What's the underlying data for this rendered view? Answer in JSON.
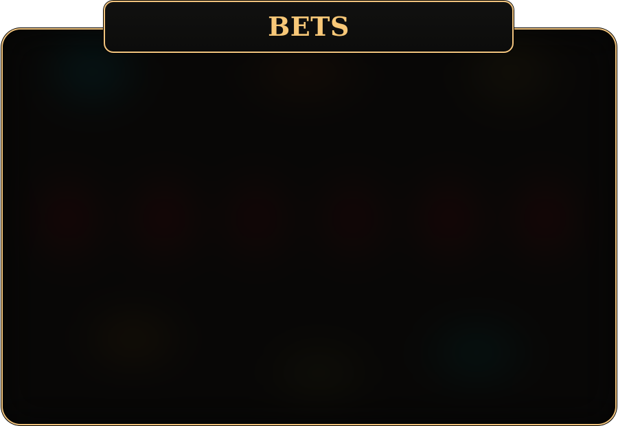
{
  "panel": {
    "title": "BETS"
  },
  "colors": {
    "accent_gold": "#f2c47e",
    "title_text": "#f8c878",
    "panel_background": "#080706"
  }
}
